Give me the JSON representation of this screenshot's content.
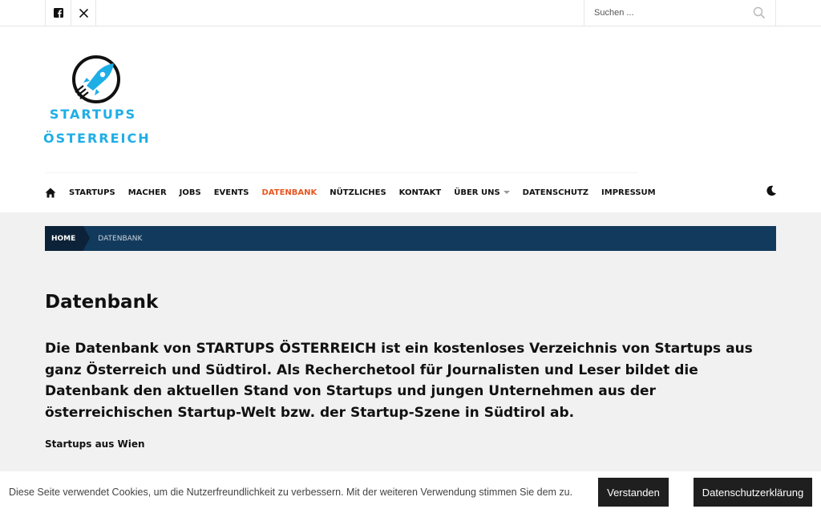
{
  "search": {
    "placeholder": "Suchen ..."
  },
  "logo": {
    "line1": "STARTUPS",
    "line2": "ÖSTERREICH"
  },
  "nav": {
    "items": [
      "STARTUPS",
      "MACHER",
      "JOBS",
      "EVENTS",
      "DATENBANK",
      "NÜTZLICHES",
      "KONTAKT",
      "ÜBER UNS",
      "DATENSCHUTZ",
      "IMPRESSUM"
    ]
  },
  "breadcrumb": {
    "home": "HOME",
    "current": "DATENBANK"
  },
  "page": {
    "title": "Datenbank",
    "lead": "Die Datenbank von STARTUPS ÖSTERREICH ist ein kostenloses Verzeichnis von Startups aus ganz Österreich und Südtirol. Als Recherchetool für Journalisten und Leser bildet die Datenbank den aktuellen Stand von Startups und jungen Unternehmen aus der österreichischen Startup-Welt bzw. der Startup-Szene in Südtirol ab.",
    "subheading": "Startups aus Wien"
  },
  "cookie": {
    "text": "Diese Seite verwendet Cookies, um die Nutzerfreundlichkeit zu verbessern. Mit der weiteren Verwendung stimmen Sie dem zu.",
    "accept": "Verstanden",
    "privacy": "Datenschutzerklärung"
  },
  "colors": {
    "accent": "#e8561f",
    "brand": "#1eaee6",
    "breadcrumb": "#123a5c"
  }
}
